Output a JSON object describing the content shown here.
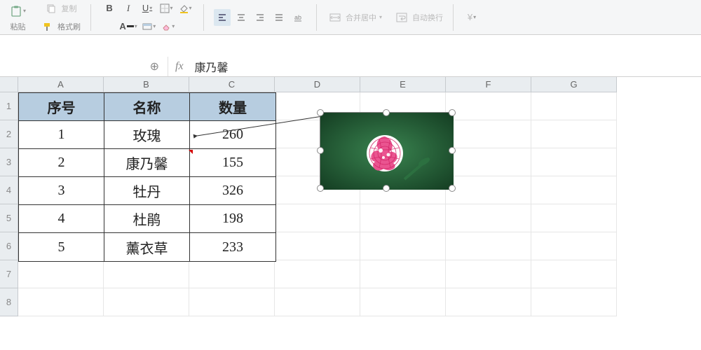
{
  "ribbon": {
    "paste_label": "粘贴",
    "copy_label": "复制",
    "format_painter_label": "格式刷",
    "merge_center_label": "合并居中",
    "wrap_text_label": "自动换行",
    "currency_symbol": "¥"
  },
  "formula_bar": {
    "zoom_icon": "⊕",
    "fx": "fx",
    "value": "康乃馨"
  },
  "grid": {
    "columns": [
      "A",
      "B",
      "C",
      "D",
      "E",
      "F",
      "G"
    ],
    "visible_rows": 8
  },
  "table": {
    "headers": [
      "序号",
      "名称",
      "数量"
    ],
    "rows": [
      {
        "no": "1",
        "name": "玫瑰",
        "qty": "260"
      },
      {
        "no": "2",
        "name": "康乃馨",
        "qty": "155"
      },
      {
        "no": "3",
        "name": "牡丹",
        "qty": "326"
      },
      {
        "no": "4",
        "name": "杜鹃",
        "qty": "198"
      },
      {
        "no": "5",
        "name": "薰衣草",
        "qty": "233"
      }
    ]
  },
  "floating_image": {
    "description": "carnation-flower-photo",
    "selected": true,
    "position": {
      "over_cells": "D2:D3"
    }
  }
}
